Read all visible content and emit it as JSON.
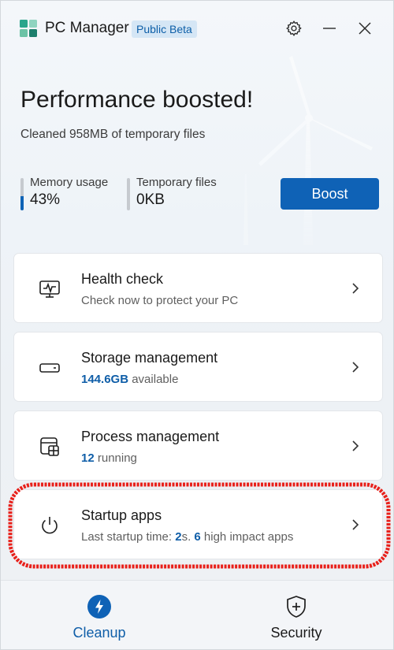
{
  "titlebar": {
    "app_name": "PC Manager",
    "badge": "Public Beta",
    "settings_icon": "gear-icon",
    "minimize_icon": "minimize-icon",
    "close_icon": "close-icon"
  },
  "hero": {
    "title": "Performance boosted!",
    "subtitle": "Cleaned 958MB of temporary files"
  },
  "stats": {
    "memory": {
      "label": "Memory usage",
      "value": "43%",
      "level": 0.43
    },
    "temp": {
      "label": "Temporary files",
      "value": "0KB",
      "level": 0
    }
  },
  "boost_button": "Boost",
  "cards": {
    "health": {
      "title": "Health check",
      "subtitle": "Check now to protect your PC",
      "icon": "health-monitor-icon"
    },
    "storage": {
      "title": "Storage management",
      "value": "144.6GB",
      "suffix": " available",
      "icon": "storage-drive-icon"
    },
    "process": {
      "title": "Process management",
      "value": "12",
      "suffix": " running",
      "icon": "process-window-icon"
    },
    "startup": {
      "title": "Startup apps",
      "prefix": "Last startup time: ",
      "time_value": "2",
      "time_unit": "s. ",
      "apps_value": "6",
      "apps_suffix": " high impact apps",
      "icon": "power-icon"
    }
  },
  "nav": {
    "cleanup": {
      "label": "Cleanup",
      "icon": "lightning-icon"
    },
    "security": {
      "label": "Security",
      "icon": "shield-plus-icon"
    }
  },
  "colors": {
    "accent": "#0f62b6",
    "highlight": "#e8201a"
  }
}
